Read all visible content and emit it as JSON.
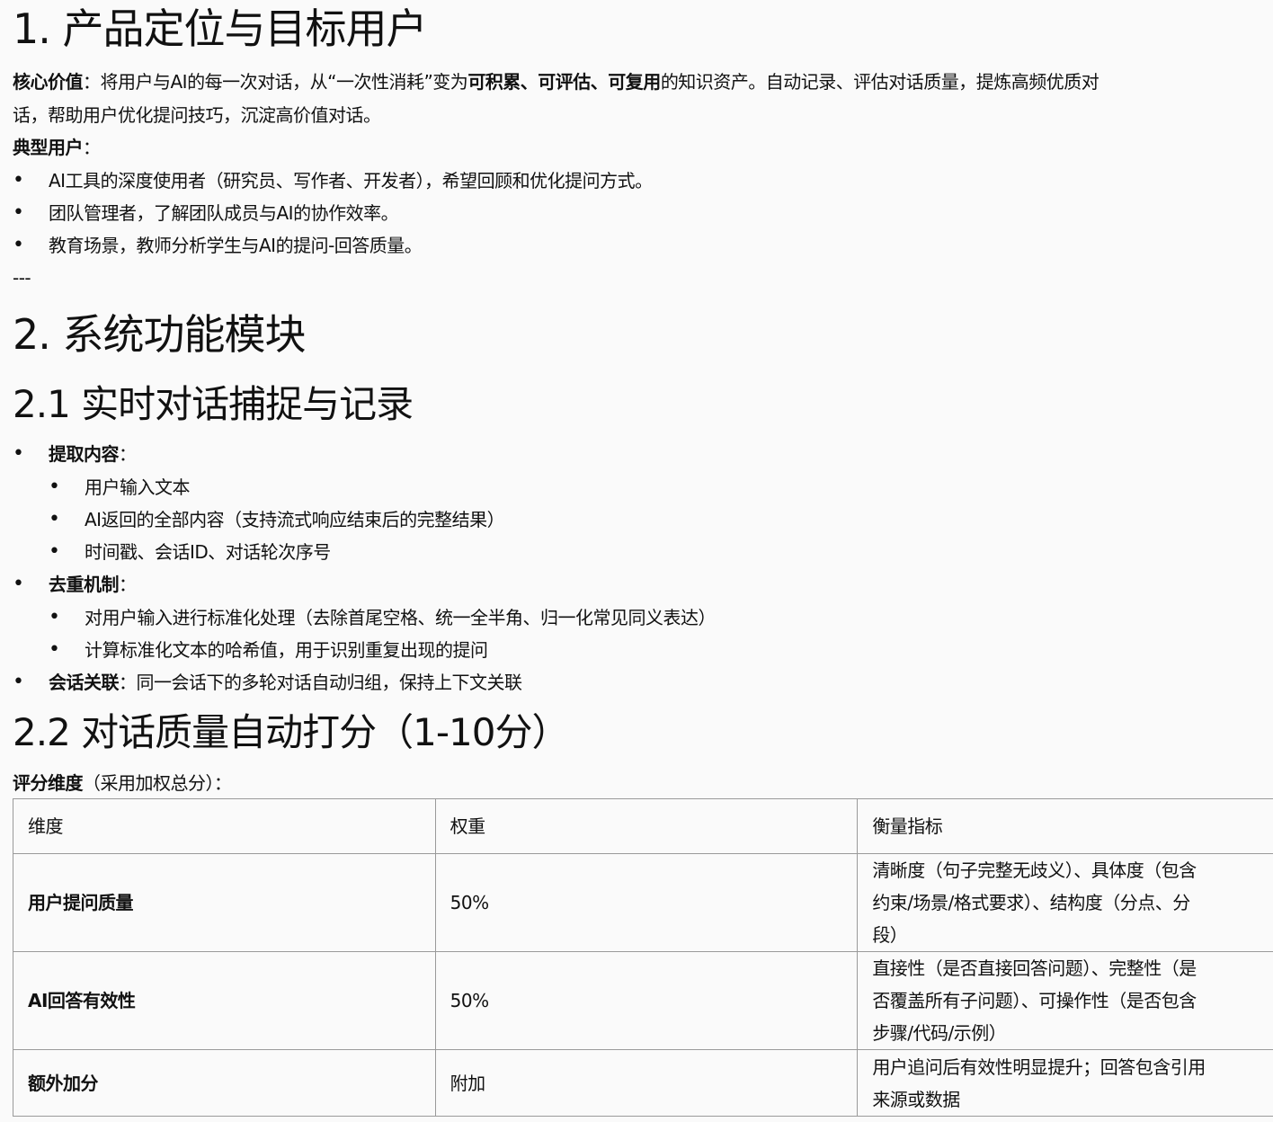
{
  "section1": {
    "heading": "1. 产品定位与目标用户",
    "core_value_label": "核心价值",
    "core_value_line1_a": "：将用户与AI的每一次对话，从“一次性消耗”变为",
    "core_value_bold": "可积累、可评估、可复用",
    "core_value_line1_b": "的知识资产。自动记录、评估对话质量，提炼高频优质对",
    "core_value_line2": "话，帮助用户优化提问技巧，沉淀高价值对话。",
    "typical_users_label": "典型用户",
    "typical_users_suffix": "：",
    "users": [
      "AI工具的深度使用者（研究员、写作者、开发者），希望回顾和优化提问方式。",
      "团队管理者，了解团队成员与AI的协作效率。",
      "教育场景，教师分析学生与AI的提问-回答质量。"
    ],
    "divider": "---"
  },
  "section2": {
    "heading": "2. 系统功能模块",
    "sub1": {
      "heading": "2.1 实时对话捕捉与记录",
      "extract_label": "提取内容",
      "extract_items": [
        "用户输入文本",
        "AI返回的全部内容（支持流式响应结束后的完整结果）",
        "时间戳、会话ID、对话轮次序号"
      ],
      "dedup_label": "去重机制",
      "dedup_items": [
        "对用户输入进行标准化处理（去除首尾空格、统一全半角、归一化常见同义表达）",
        "计算标准化文本的哈希值，用于识别重复出现的提问"
      ],
      "session_label": "会话关联",
      "session_text": "：同一会话下的多轮对话自动归组，保持上下文关联",
      "colon": "："
    },
    "sub2": {
      "heading": "2.2 对话质量自动打分（1-10分）",
      "dims_label": "评分维度",
      "dims_suffix": "（采用加权总分）：",
      "table": {
        "headers": [
          "维度",
          "权重",
          "衡量指标"
        ],
        "rows": [
          {
            "dim": "用户提问质量",
            "weight": "50%",
            "metric_lines": [
              "清晰度（句子完整无歧义）、具体度（包含",
              "约束/场景/格式要求）、结构度（分点、分",
              "段）"
            ]
          },
          {
            "dim": "AI回答有效性",
            "weight": "50%",
            "metric_lines": [
              "直接性（是否直接回答问题）、完整性（是",
              "否覆盖所有子问题）、可操作性（是否包含",
              "步骤/代码/示例）"
            ]
          },
          {
            "dim": "额外加分",
            "weight": "附加",
            "metric_lines": [
              "用户追问后有效性明显提升；回答包含引用",
              "来源或数据"
            ]
          }
        ]
      }
    }
  }
}
